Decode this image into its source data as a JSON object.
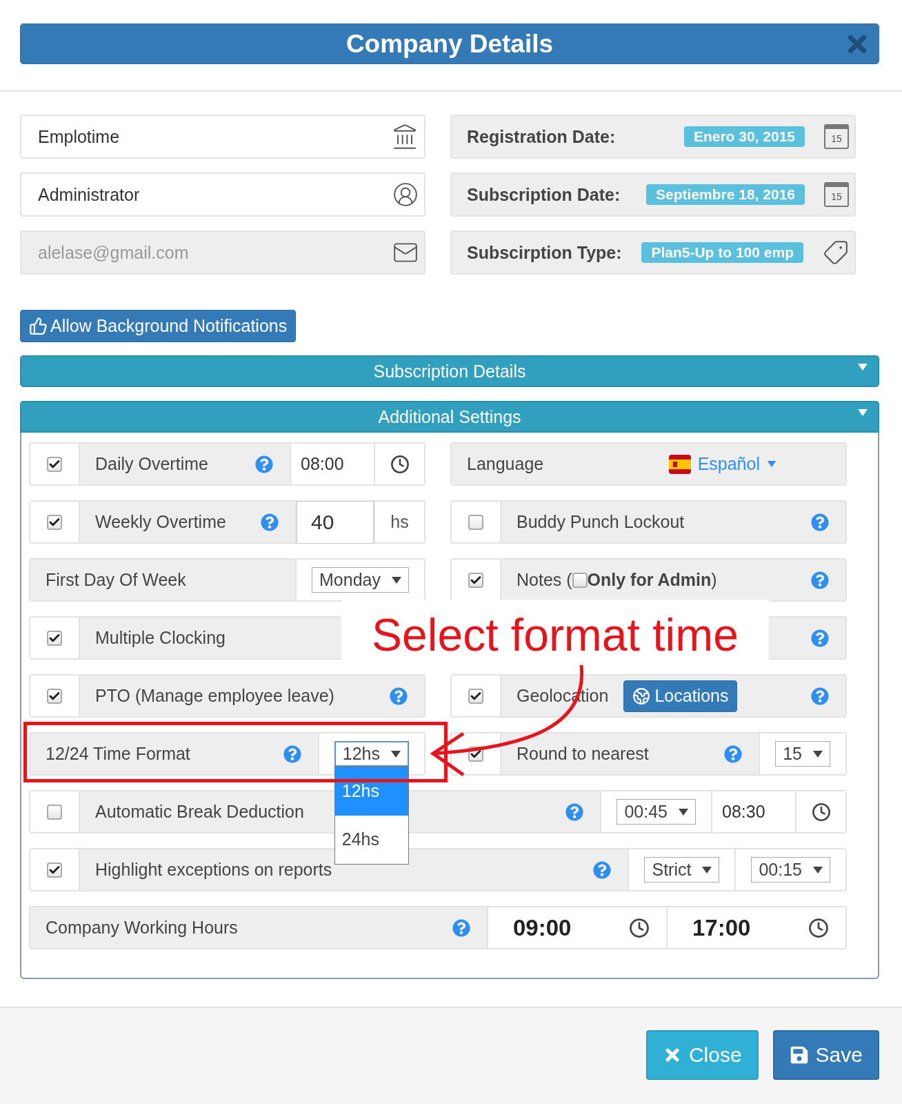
{
  "dialog": {
    "title": "Company Details"
  },
  "fields": [
    {
      "value": "Emplotime",
      "disabled": false
    },
    {
      "value": "Administrator",
      "disabled": false
    },
    {
      "value": "alelase@gmail.com",
      "disabled": true
    }
  ],
  "info": [
    {
      "label": "Registration Date:",
      "badge": "Enero 30, 2015",
      "day": "15"
    },
    {
      "label": "Subscription Date:",
      "badge": "Septiembre 18, 2016",
      "day": "15"
    },
    {
      "label": "Subscirption Type:",
      "badge": "Plan5-Up to 100 emp"
    }
  ],
  "notify_button": {
    "label": "Allow Background Notifications"
  },
  "sections": [
    {
      "title": "Subscription Details",
      "expanded": false
    },
    {
      "title": "Additional Settings",
      "expanded": true,
      "rows": [
        {
          "cells": [
            {
              "label": "Daily Overtime",
              "checked": true,
              "help": true,
              "controls": [
                {
                  "kind": "input",
                  "value": "08:00"
                },
                {
                  "kind": "clock"
                }
              ]
            },
            {
              "label": "Language",
              "controls": [
                {
                  "kind": "language",
                  "value": "Español"
                }
              ]
            }
          ]
        },
        {
          "cells": [
            {
              "label": "Weekly Overtime",
              "checked": true,
              "help": true,
              "controls": [
                {
                  "kind": "number_input",
                  "value": "40"
                },
                {
                  "kind": "unit",
                  "text": "hs"
                }
              ]
            },
            {
              "label": "Buddy Punch Lockout",
              "checked": false,
              "help": true
            }
          ]
        },
        {
          "cells": [
            {
              "label": "First Day Of Week",
              "controls": [
                {
                  "kind": "select",
                  "value": "Monday"
                }
              ]
            },
            {
              "label": "Notes (",
              "checked": true,
              "help": true,
              "inline_check": {
                "checked": false,
                "text": "**Only for Admin**)"
              }
            }
          ]
        },
        {
          "cells": [
            {
              "label": "Multiple Clocking",
              "checked": true
            },
            {
              "help": true
            }
          ]
        },
        {
          "cells": [
            {
              "label": "PTO (Manage employee leave)",
              "checked": true,
              "help": true
            },
            {
              "label": "Geolocation",
              "checked": true,
              "help": true,
              "controls": [
                {
                  "kind": "button",
                  "label": "Locations"
                }
              ]
            }
          ]
        },
        {
          "cells": [
            {
              "label": "12/24 Time Format",
              "help": true,
              "controls": [
                {
                  "kind": "select",
                  "value": "12hs",
                  "open": true,
                  "options": [
                    {
                      "label": "12hs",
                      "selected": true
                    },
                    {
                      "label": "24hs",
                      "selected": false
                    }
                  ]
                }
              ]
            },
            {
              "label": "Round to nearest",
              "checked": true,
              "help": true,
              "controls": [
                {
                  "kind": "select",
                  "value": "15"
                }
              ]
            }
          ]
        },
        {
          "cells": [
            {
              "label": "Automatic Break Deduction",
              "checked": false,
              "help": true,
              "controls": [
                {
                  "kind": "select",
                  "value": "00:45"
                },
                {
                  "kind": "input",
                  "value": "08:30"
                },
                {
                  "kind": "clock"
                }
              ]
            }
          ]
        },
        {
          "cells": [
            {
              "label": "Highlight exceptions on reports",
              "checked": true,
              "help": true,
              "controls": [
                {
                  "kind": "select",
                  "value": "Strict"
                },
                {
                  "kind": "select",
                  "value": "00:15"
                }
              ]
            }
          ]
        },
        {
          "cells": [
            {
              "label": "Company Working Hours",
              "help": true,
              "controls": [
                {
                  "kind": "time",
                  "value": "09:00"
                },
                {
                  "kind": "time",
                  "value": "17:00"
                }
              ]
            }
          ]
        }
      ]
    }
  ],
  "annotation": {
    "text": "Select format time"
  },
  "footer": {
    "buttons": [
      {
        "kind": "close",
        "label": "Close"
      },
      {
        "kind": "save",
        "label": "Save"
      }
    ]
  }
}
